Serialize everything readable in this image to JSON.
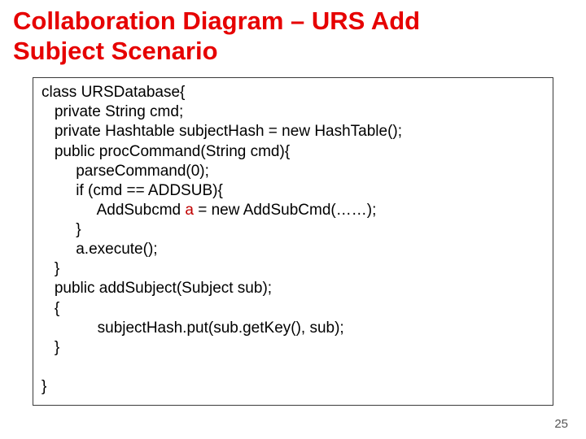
{
  "title_line1": "Collaboration Diagram – URS Add",
  "title_line2": "Subject Scenario",
  "code": {
    "l01": "class URSDatabase{",
    "l02": "   private String cmd;",
    "l03": "   private Hashtable subjectHash = new HashTable();",
    "l04": "   public procCommand(String cmd){",
    "l05": "        parseCommand(0);",
    "l06": "        if (cmd == ADDSUB){",
    "l07a": "             AddSubcmd ",
    "l07b": "a",
    "l07c": " = new AddSubCmd(……);",
    "l08": "        }",
    "l09": "        a.execute();",
    "l10": "   }",
    "l11": "   public addSubject(Subject sub);",
    "l12": "   {",
    "l13": "             subjectHash.put(sub.getKey(), sub);",
    "l14": "   }",
    "l15": " ",
    "l16": "}"
  },
  "page_number": "25"
}
